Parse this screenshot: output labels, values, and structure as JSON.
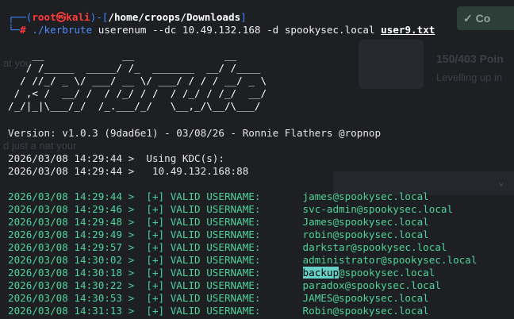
{
  "background_page": {
    "fragment_1": "at you",
    "fragment_2": "d just a nat your",
    "button_label": "Co",
    "points_title": "150/403 Poin",
    "points_sub": "Levelling up in"
  },
  "prompt": {
    "user_host_prefix": "┌──(",
    "user": "root",
    "at_symbol": "㉿",
    "host": "kali",
    "mid": ")-[",
    "path": "/home/croops/Downloads",
    "end": "]",
    "line2_prefix": "└─",
    "hash": "#",
    "command": "./kerbrute",
    "args": " userenum --dc 10.49.132.168 -d spookysec.local ",
    "wordlist": "user9.txt"
  },
  "banner_lines": [
    "    __             __               __     ",
    "   / /_____  _____/ /_  _______  __/ /____ ",
    "  / //_/ _ \\/ ___/ __ \\/ ___/ / / / __/ _ \\",
    " / ,< /  __/ /  / /_/ / /  / /_/ / /_/  __/",
    "/_/|_|\\___/_/  /_.___/_/   \\__,_/\\__/\\___/ "
  ],
  "version_line": "Version: v1.0.3 (9dad6e1) - 03/08/26 - Ronnie Flathers @ropnop",
  "kdc_lines": [
    "2026/03/08 14:29:44 >  Using KDC(s):",
    "2026/03/08 14:29:44 >   10.49.132.168:88"
  ],
  "results": [
    {
      "ts": "2026/03/08 14:29:44 >",
      "tag": "[+] VALID USERNAME:",
      "user": "james@spookysec.local",
      "highlight": ""
    },
    {
      "ts": "2026/03/08 14:29:46 >",
      "tag": "[+] VALID USERNAME:",
      "user": "svc-admin@spookysec.local",
      "highlight": ""
    },
    {
      "ts": "2026/03/08 14:29:48 >",
      "tag": "[+] VALID USERNAME:",
      "user": "James@spookysec.local",
      "highlight": ""
    },
    {
      "ts": "2026/03/08 14:29:49 >",
      "tag": "[+] VALID USERNAME:",
      "user": "robin@spookysec.local",
      "highlight": ""
    },
    {
      "ts": "2026/03/08 14:29:57 >",
      "tag": "[+] VALID USERNAME:",
      "user": "darkstar@spookysec.local",
      "highlight": ""
    },
    {
      "ts": "2026/03/08 14:30:02 >",
      "tag": "[+] VALID USERNAME:",
      "user": "administrator@spookysec.local",
      "highlight": ""
    },
    {
      "ts": "2026/03/08 14:30:18 >",
      "tag": "[+] VALID USERNAME:",
      "user": "@spookysec.local",
      "highlight": "backup"
    },
    {
      "ts": "2026/03/08 14:30:22 >",
      "tag": "[+] VALID USERNAME:",
      "user": "paradox@spookysec.local",
      "highlight": ""
    },
    {
      "ts": "2026/03/08 14:30:53 >",
      "tag": "[+] VALID USERNAME:",
      "user": "JAMES@spookysec.local",
      "highlight": ""
    },
    {
      "ts": "2026/03/08 14:31:13 >",
      "tag": "[+] VALID USERNAME:",
      "user": "Robin@spookysec.local",
      "highlight": ""
    }
  ],
  "colors": {
    "terminal_bg": "#1d1f23",
    "prompt_blue": "#3b86ff",
    "prompt_red": "#ff3b3b",
    "valid_green": "#4fd39a",
    "selection": "#66d1c6"
  }
}
